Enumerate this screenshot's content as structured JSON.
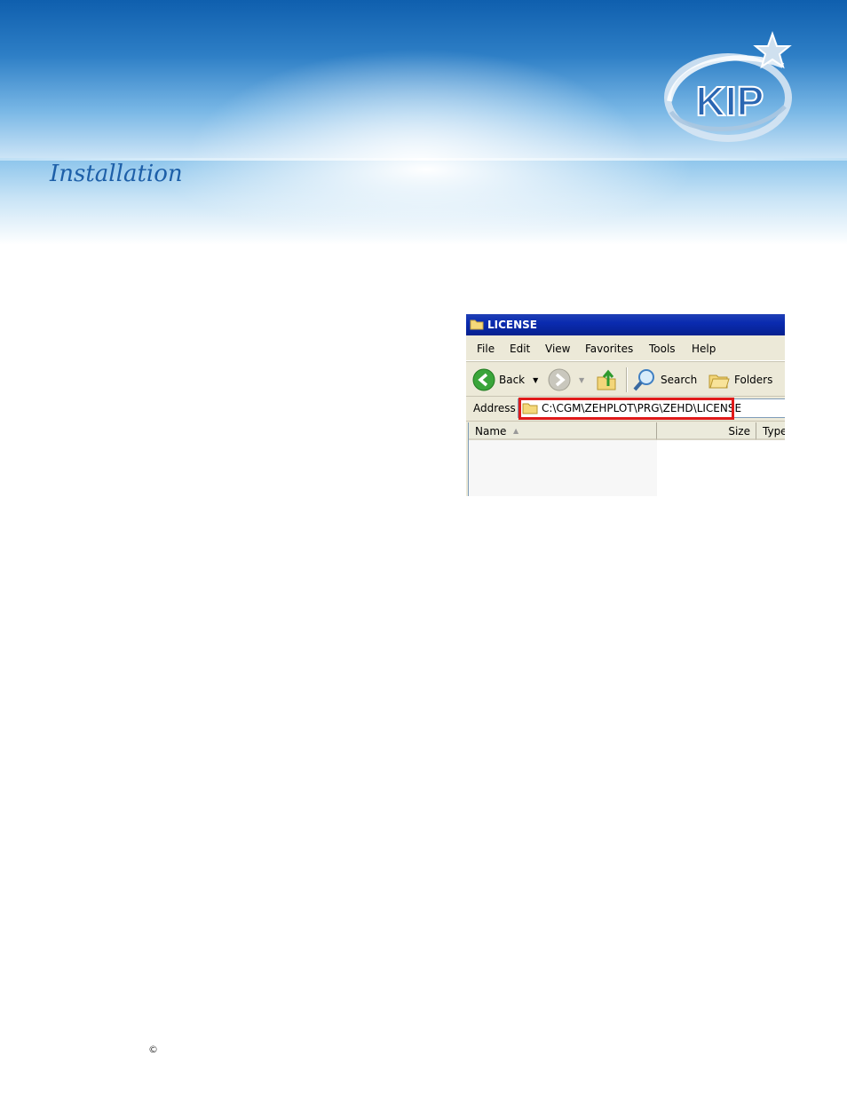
{
  "header": {
    "section_title": "Installation",
    "logo_text": "KIP"
  },
  "window": {
    "title": "LICENSE",
    "menu": [
      "File",
      "Edit",
      "View",
      "Favorites",
      "Tools",
      "Help"
    ],
    "toolbar": {
      "back_label": "Back",
      "search_label": "Search",
      "folders_label": "Folders"
    },
    "address": {
      "label": "Address",
      "value": "C:\\CGM\\ZEHPLOT\\PRG\\ZEHD\\LICENSE"
    },
    "columns": [
      "Name",
      "Size",
      "Type"
    ]
  },
  "footer": {
    "copyright_symbol": "©"
  },
  "colors": {
    "highlight": "#e01a1a",
    "title_blue": "#1d5fa8"
  }
}
